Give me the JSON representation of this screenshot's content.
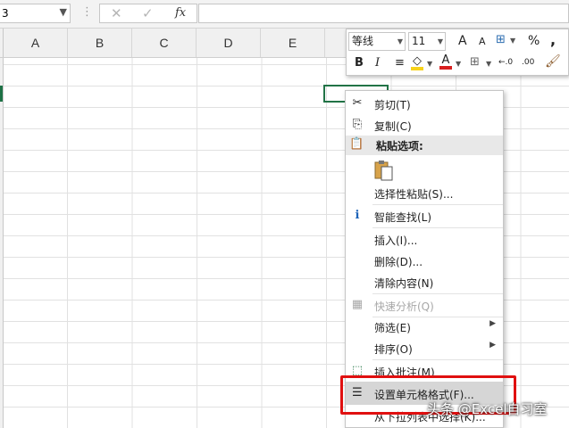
{
  "name_box": {
    "value": "3"
  },
  "formula_bar": {
    "cancel_icon": "✕",
    "enter_icon": "✓",
    "fx_label": "fx"
  },
  "columns": [
    "A",
    "B",
    "C",
    "D",
    "E"
  ],
  "mini_toolbar": {
    "font_name": "等线",
    "font_size": "11",
    "grow_font": "A",
    "shrink_font": "A",
    "percent": "%",
    "comma": ",",
    "bold": "B",
    "italic": "I",
    "font_color_letter": "A",
    "decimal_inc": "←.0",
    "decimal_dec": ".00",
    "accent_fill": "#f7d21a",
    "accent_font": "#d81f1f"
  },
  "context_menu": {
    "items": [
      {
        "label": "剪切(T)",
        "icon": "scissors-icon",
        "glyph": "✂"
      },
      {
        "label": "复制(C)",
        "icon": "copy-icon",
        "glyph": "⎘"
      },
      {
        "label": "粘贴选项:",
        "icon": "paste-icon",
        "glyph": "📋"
      },
      {
        "label": "选择性粘贴(S)..."
      },
      {
        "label": "智能查找(L)",
        "icon": "smart-lookup-icon",
        "glyph": "ℹ"
      },
      {
        "label": "插入(I)..."
      },
      {
        "label": "删除(D)..."
      },
      {
        "label": "清除内容(N)"
      },
      {
        "label": "快速分析(Q)",
        "icon": "quick-analysis-icon",
        "glyph": "▦",
        "disabled": true
      },
      {
        "label": "筛选(E)",
        "submenu": true
      },
      {
        "label": "排序(O)",
        "submenu": true
      },
      {
        "label": "插入批注(M)",
        "icon": "insert-comment-icon",
        "glyph": "⬚"
      },
      {
        "label": "设置单元格格式(F)...",
        "icon": "format-cells-icon",
        "glyph": "☰"
      },
      {
        "label": "从下拉列表中选择(K)..."
      }
    ],
    "submenu_arrow": "▶"
  },
  "watermark": "头条 @Excel自习室"
}
